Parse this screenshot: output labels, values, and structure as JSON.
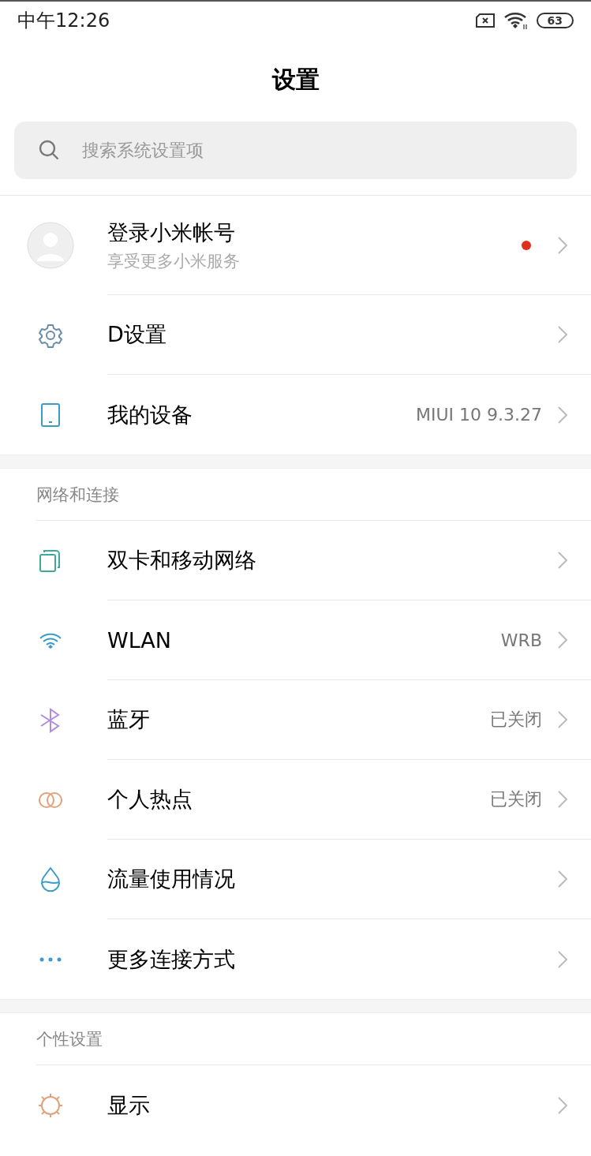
{
  "status_bar": {
    "time": "中午12:26",
    "battery": "63"
  },
  "title": "设置",
  "search": {
    "placeholder": "搜索系统设置项"
  },
  "account": {
    "title": "登录小米帐号",
    "subtitle": "享受更多小米服务",
    "badge": true
  },
  "sections": [
    {
      "items": [
        {
          "label": "D设置"
        },
        {
          "label": "我的设备",
          "value": "MIUI 10 9.3.27"
        }
      ]
    },
    {
      "header": "网络和连接",
      "items": [
        {
          "label": "双卡和移动网络"
        },
        {
          "label": "WLAN",
          "value": "WRB"
        },
        {
          "label": "蓝牙",
          "value": "已关闭"
        },
        {
          "label": "个人热点",
          "value": "已关闭"
        },
        {
          "label": "流量使用情况"
        },
        {
          "label": "更多连接方式"
        }
      ]
    },
    {
      "header": "个性设置",
      "items": [
        {
          "label": "显示"
        }
      ]
    }
  ]
}
